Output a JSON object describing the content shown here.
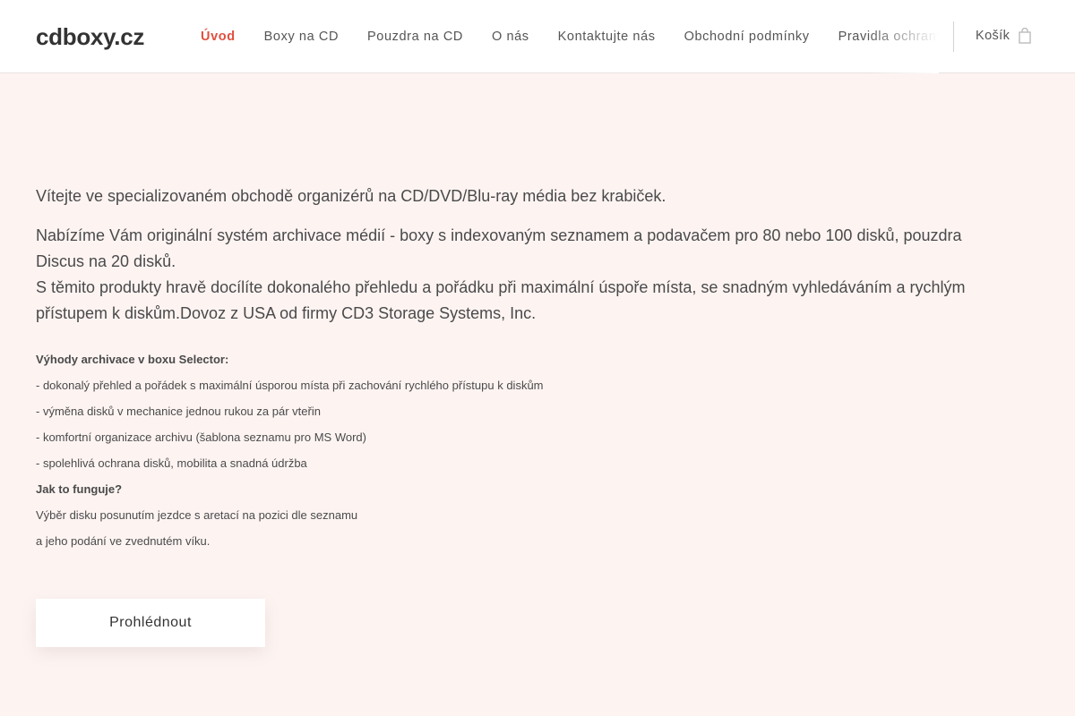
{
  "header": {
    "logo": "cdboxy.cz",
    "nav": [
      {
        "label": "Úvod",
        "active": true
      },
      {
        "label": "Boxy na CD"
      },
      {
        "label": "Pouzdra na CD"
      },
      {
        "label": "O nás"
      },
      {
        "label": "Kontaktujte nás"
      },
      {
        "label": "Obchodní podmínky"
      },
      {
        "label": "Pravidla ochrany"
      }
    ],
    "cart_label": "Košík",
    "cart_icon": "shopping-bag-icon"
  },
  "main": {
    "intro": "Vítejte ve specializovaném obchodě organizérů na CD/DVD/Blu-ray média bez krabiček.",
    "para_line1": "Nabízíme Vám originální systém archivace médií - boxy s indexovaným seznamem a podavačem pro 80 nebo 100 disků, pouzdra Discus na 20 disků.",
    "para_line2": "S těmito produkty hravě docílíte dokonalého přehledu a pořádku při maximální úspoře místa, se snadným vyhledáváním a rychlým přístupem k diskům.Dovoz z USA od firmy CD3 Storage Systems, Inc.",
    "advantages_title": "Výhody archivace v boxu Selector:",
    "advantages": [
      "- dokonalý přehled a pořádek s maximální úsporou místa při zachování rychlého přístupu k diskům",
      "- výměna disků v mechanice jednou rukou za pár vteřin",
      "- komfortní organizace archivu (šablona seznamu pro MS Word)",
      "- spolehlivá ochrana disků, mobilita a snadná údržba"
    ],
    "how_title": "Jak to funguje?",
    "how_lines": [
      "Výběr disku posunutím jezdce s aretací na pozici dle seznamu",
      "a jeho podání ve zvednutém víku."
    ],
    "button_label": "Prohlédnout"
  },
  "colors": {
    "accent": "#e0503f",
    "background": "#fdf4f2",
    "header_bg": "#ffffff"
  }
}
